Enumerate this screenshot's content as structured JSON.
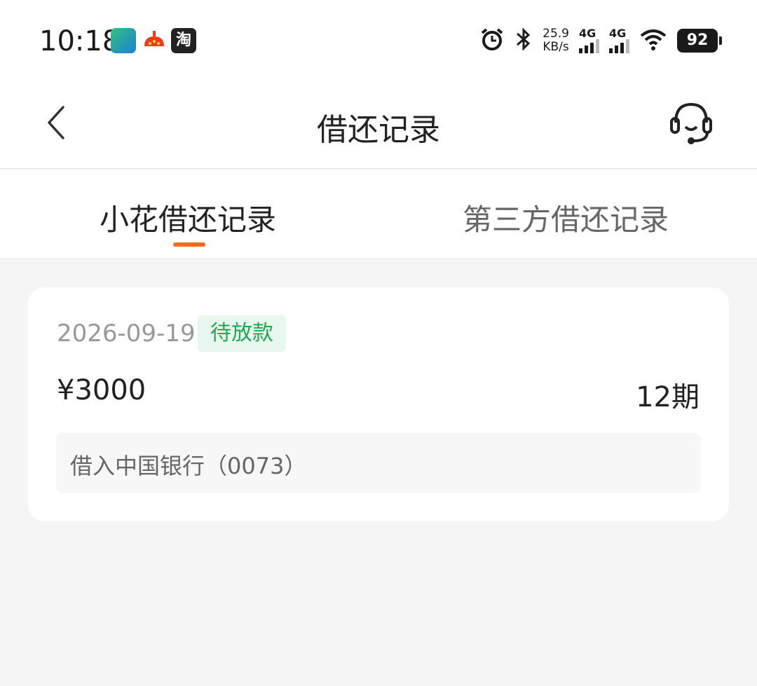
{
  "status_bar": {
    "time": "10:18",
    "app3_label": "淘",
    "speed_value": "25.9",
    "speed_unit": "KB/s",
    "sim1_label": "4G",
    "sim2_label": "4G",
    "battery": "92"
  },
  "header": {
    "title": "借还记录"
  },
  "tabs": [
    {
      "label": "小花借还记录",
      "active": true
    },
    {
      "label": "第三方借还记录",
      "active": false
    }
  ],
  "record": {
    "date": "2026-09-19",
    "status": "待放款",
    "amount": "¥3000",
    "periods": "12期",
    "bank": "借入中国银行（0073）"
  },
  "colors": {
    "accent": "#f26a1b",
    "status_text": "#1fa84f",
    "status_bg": "#e9f8ef",
    "background": "#f5f5f5"
  }
}
